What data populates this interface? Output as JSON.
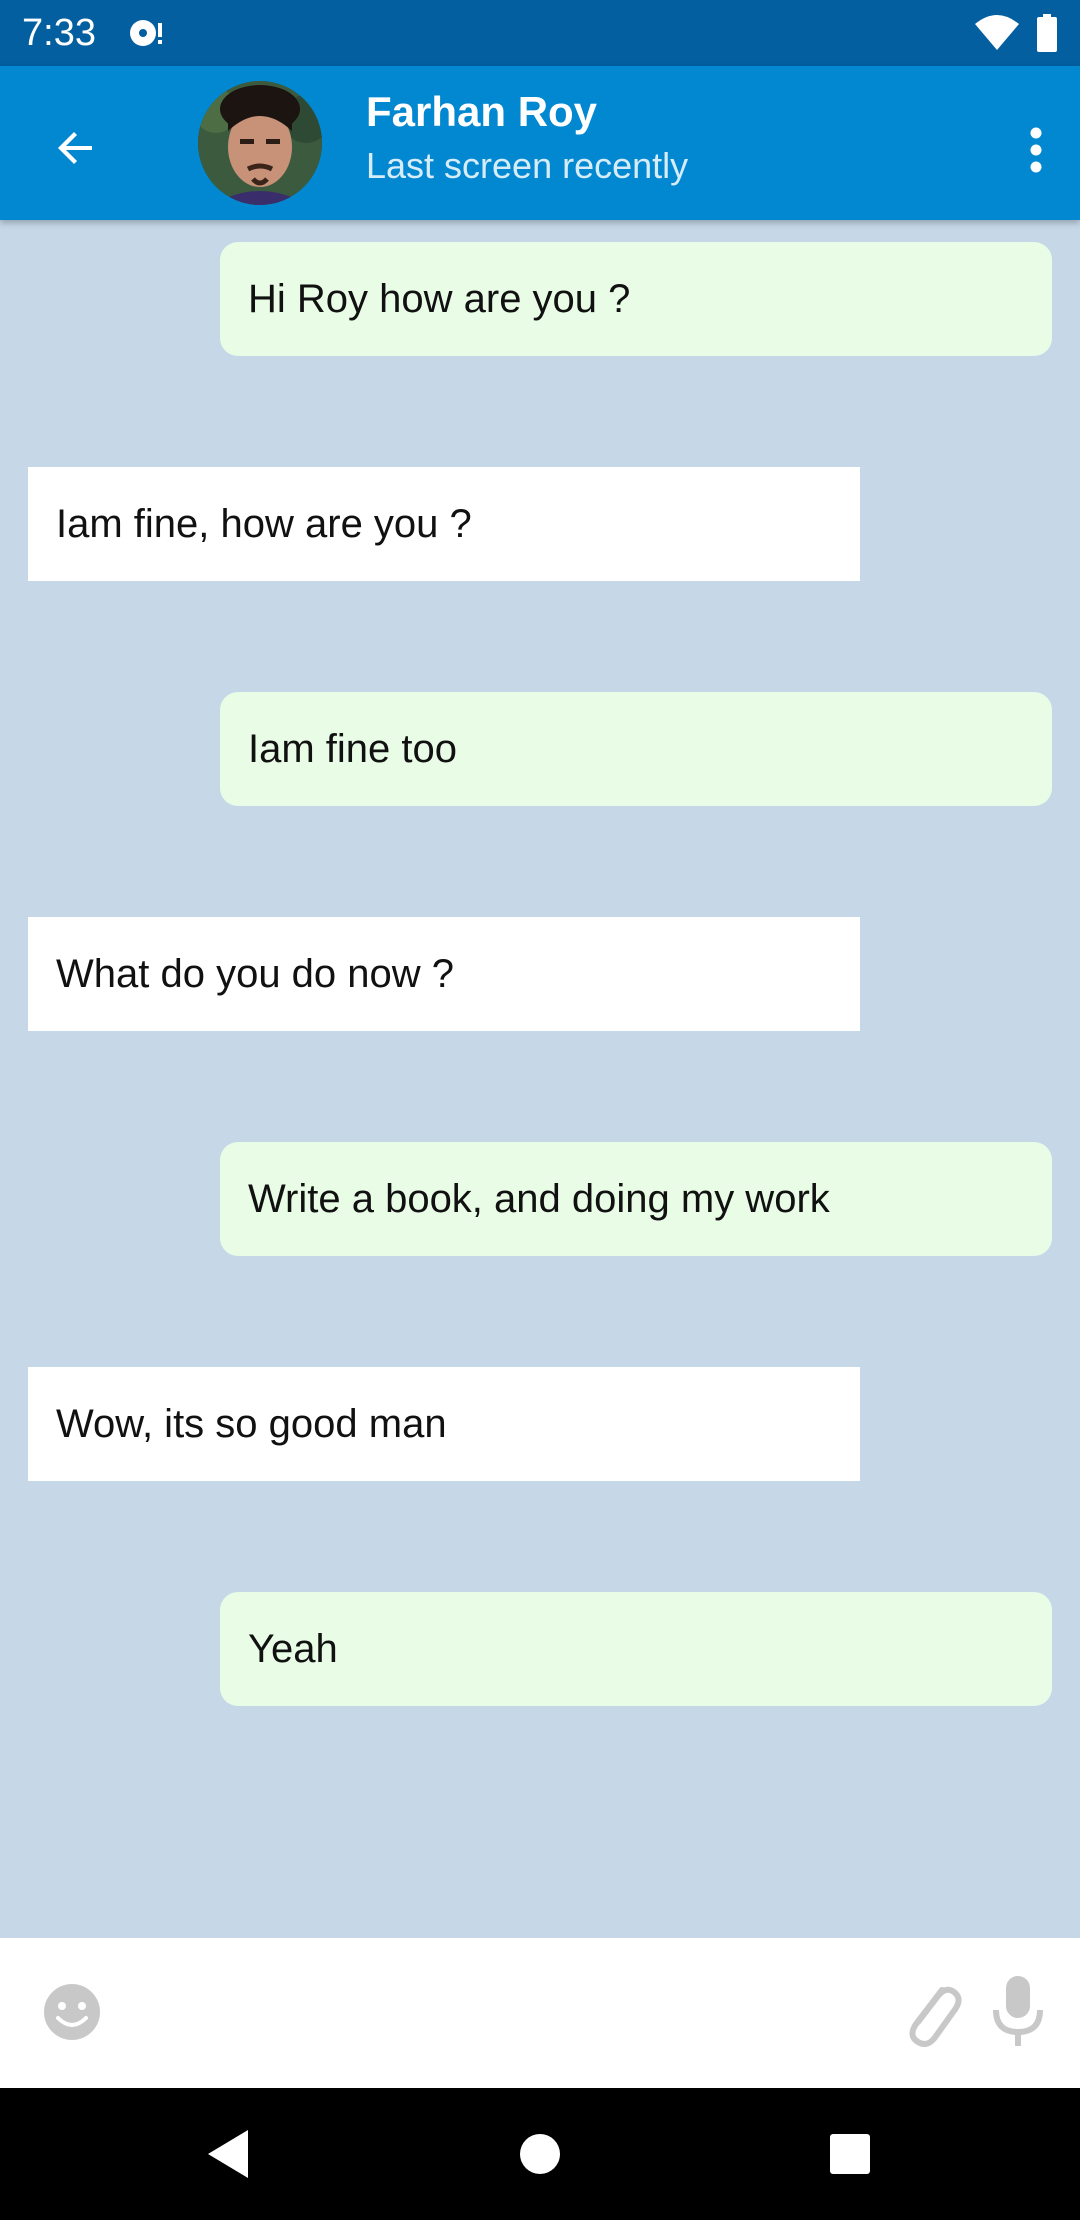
{
  "status_bar": {
    "time": "7:33"
  },
  "header": {
    "name": "Farhan Roy",
    "status": "Last screen recently"
  },
  "messages": [
    {
      "type": "sent",
      "text": "Hi Roy how are you ?"
    },
    {
      "type": "received",
      "text": "Iam fine, how are you ?"
    },
    {
      "type": "sent",
      "text": "Iam fine too"
    },
    {
      "type": "received",
      "text": "What do you do now ?"
    },
    {
      "type": "sent",
      "text": "Write a book, and doing my work"
    },
    {
      "type": "received",
      "text": "Wow, its so good man"
    },
    {
      "type": "sent",
      "text": "Yeah"
    }
  ],
  "input": {
    "placeholder": ""
  },
  "icons": {
    "back": "arrow-back-icon",
    "more": "more-vert-icon",
    "emoji": "emoji-icon",
    "attach": "paperclip-icon",
    "mic": "microphone-icon"
  },
  "colors": {
    "status_bar": "#035f9f",
    "app_bar": "#0288d1",
    "chat_background": "#c6d8e8",
    "sent_bubble": "#e8fce6",
    "received_bubble": "#ffffff"
  }
}
